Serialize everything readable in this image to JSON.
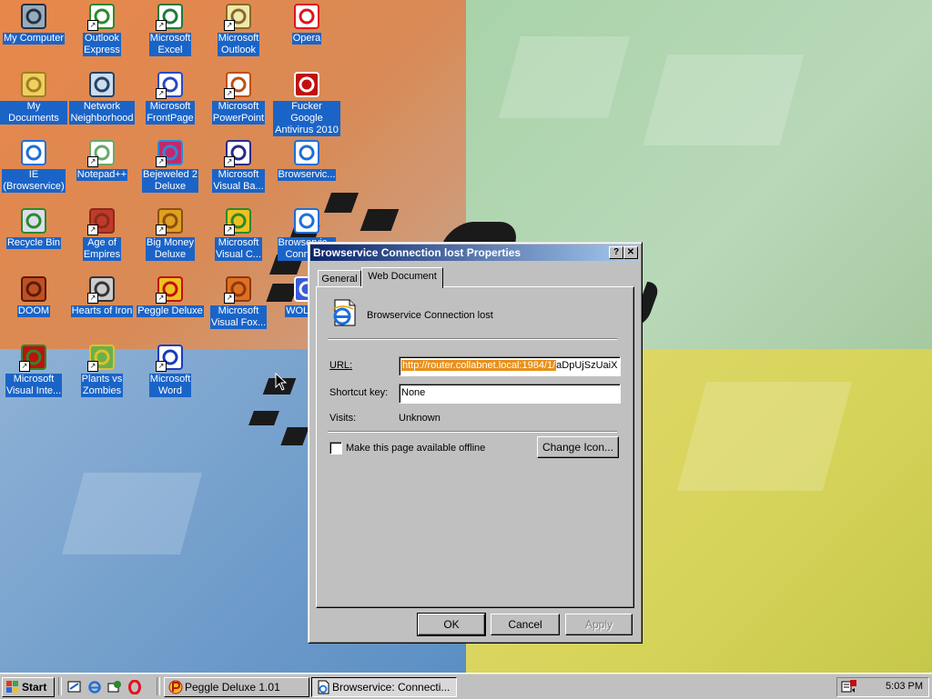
{
  "desktop": {
    "icons": [
      {
        "label": "My Computer",
        "icon": "computer-icon",
        "shortcut": false
      },
      {
        "label": "Outlook\nExpress",
        "icon": "outlook-express-icon",
        "shortcut": true
      },
      {
        "label": "Microsoft\nExcel",
        "icon": "excel-icon",
        "shortcut": true
      },
      {
        "label": "Microsoft\nOutlook",
        "icon": "outlook-icon",
        "shortcut": true
      },
      {
        "label": "Opera",
        "icon": "opera-icon",
        "shortcut": false
      },
      {
        "label": "My Documents",
        "icon": "folder-icon",
        "shortcut": false
      },
      {
        "label": "Network\nNeighborhood",
        "icon": "network-icon",
        "shortcut": false
      },
      {
        "label": "Microsoft\nFrontPage",
        "icon": "frontpage-icon",
        "shortcut": true
      },
      {
        "label": "Microsoft\nPowerPoint",
        "icon": "powerpoint-icon",
        "shortcut": true
      },
      {
        "label": "Fucker Google\nAntivirus 2010",
        "icon": "antivirus-icon",
        "shortcut": false
      },
      {
        "label": "IE\n(Browservice)",
        "icon": "ie-icon",
        "shortcut": false
      },
      {
        "label": "Notepad++",
        "icon": "notepad-icon",
        "shortcut": true
      },
      {
        "label": "Bejeweled 2\nDeluxe",
        "icon": "bejeweled-icon",
        "shortcut": true
      },
      {
        "label": "Microsoft\nVisual Ba...",
        "icon": "visual-basic-icon",
        "shortcut": true
      },
      {
        "label": "Browservic...",
        "icon": "ie-document-icon",
        "shortcut": false
      },
      {
        "label": "Recycle Bin",
        "icon": "recycle-bin-icon",
        "shortcut": false
      },
      {
        "label": "Age of\nEmpires",
        "icon": "age-of-empires-icon",
        "shortcut": true
      },
      {
        "label": "Big Money\nDeluxe",
        "icon": "big-money-icon",
        "shortcut": true
      },
      {
        "label": "Microsoft\nVisual C...",
        "icon": "visual-c-icon",
        "shortcut": true
      },
      {
        "label": "Browservic...\nConnec...",
        "icon": "ie-document-icon",
        "shortcut": false
      },
      {
        "label": "DOOM",
        "icon": "doom-icon",
        "shortcut": false
      },
      {
        "label": "Hearts of Iron",
        "icon": "hearts-of-iron-icon",
        "shortcut": true
      },
      {
        "label": "Peggle Deluxe",
        "icon": "peggle-icon",
        "shortcut": true
      },
      {
        "label": "Microsoft\nVisual Fox...",
        "icon": "visual-foxpro-icon",
        "shortcut": true
      },
      {
        "label": "WOLF3D",
        "icon": "wolf3d-icon",
        "shortcut": false
      },
      {
        "label": "Microsoft\nVisual Inte...",
        "icon": "visual-interdev-icon",
        "shortcut": true
      },
      {
        "label": "Plants vs\nZombies",
        "icon": "plants-vs-zombies-icon",
        "shortcut": true
      },
      {
        "label": "Microsoft\nWord",
        "icon": "word-icon",
        "shortcut": true
      }
    ]
  },
  "dialog": {
    "title": "Browservice Connection lost Properties",
    "help_button": "?",
    "close_button": "✕",
    "tabs": [
      {
        "label": "General",
        "active": false
      },
      {
        "label": "Web Document",
        "active": true
      }
    ],
    "doc_name": "Browservice Connection lost",
    "url_label": "URL:",
    "url_selected": "http://router.collabnet.local:1984/1/",
    "url_rest": "aDpUjSzUaiX",
    "shortcut_label": "Shortcut key:",
    "shortcut_value": "None",
    "visits_label": "Visits:",
    "visits_value": "Unknown",
    "offline_label": "Make this page available offline",
    "offline_checked": false,
    "change_icon_label": "Change Icon...",
    "ok_label": "OK",
    "cancel_label": "Cancel",
    "apply_label": "Apply"
  },
  "taskbar": {
    "start_label": "Start",
    "quick_launch": [
      "show-desktop-icon",
      "ie-icon",
      "outlook-express-icon",
      "opera-icon"
    ],
    "tasks": [
      {
        "label": "Peggle Deluxe 1.01",
        "icon": "peggle-icon",
        "active": false
      },
      {
        "label": "Browservice: Connecti...",
        "icon": "ie-document-icon",
        "active": true
      }
    ],
    "clock": "5:03 PM",
    "tray_icon": "volume-scheduler-icon"
  },
  "colors": {
    "titlebar_start": "#0a246a",
    "titlebar_end": "#a6caf0",
    "selection": "#1a64c8",
    "url_highlight": "#e8901a"
  }
}
